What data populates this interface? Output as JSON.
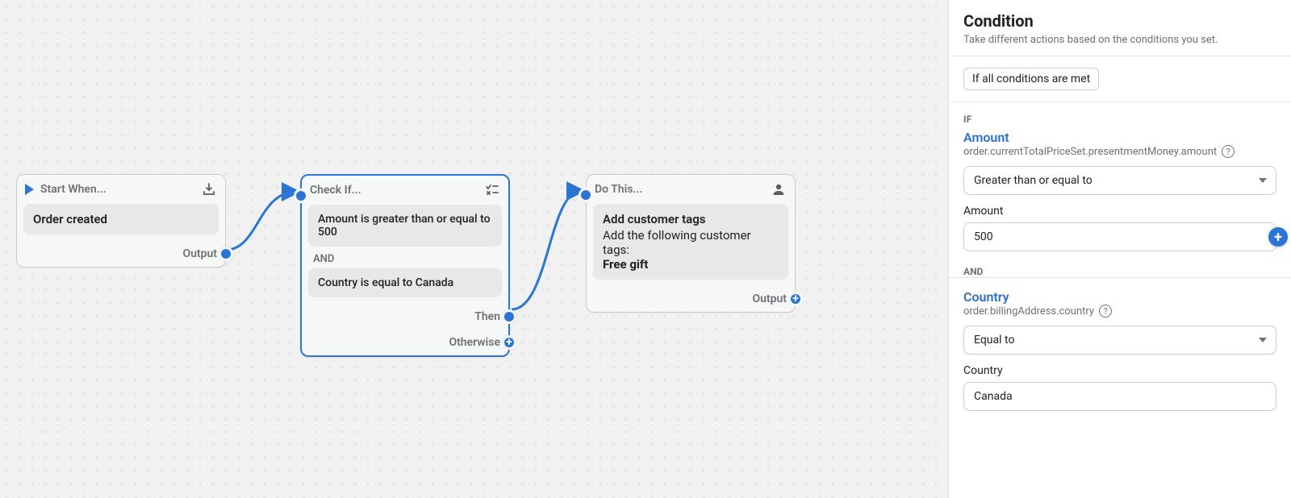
{
  "canvas": {
    "start": {
      "headerLabel": "Start When...",
      "titleLabel": "Order created",
      "outputLabel": "Output"
    },
    "condition": {
      "headerLabel": "Check If...",
      "cond1": "Amount is greater than or equal to 500",
      "andLabel": "AND",
      "cond2": "Country is equal to Canada",
      "thenLabel": "Then",
      "otherwiseLabel": "Otherwise"
    },
    "action": {
      "headerLabel": "Do This...",
      "title": "Add customer tags",
      "subtitle": "Add the following customer tags:",
      "tagValue": "Free gift",
      "outputLabel": "Output"
    }
  },
  "panel": {
    "title": "Condition",
    "subtitle": "Take different actions based on the conditions you set.",
    "matchModeLabel": "If all conditions are met",
    "ifLabel": "IF",
    "andLabel": "AND",
    "cond1": {
      "fieldName": "Amount",
      "fieldPath": "order.currentTotalPriceSet.presentmentMoney.amount",
      "operatorLabel": "Greater than or equal to",
      "valueLabel": "Amount",
      "value": "500"
    },
    "cond2": {
      "fieldName": "Country",
      "fieldPath": "order.billingAddress.country",
      "operatorLabel": "Equal to",
      "valueLabel": "Country",
      "value": "Canada"
    }
  }
}
